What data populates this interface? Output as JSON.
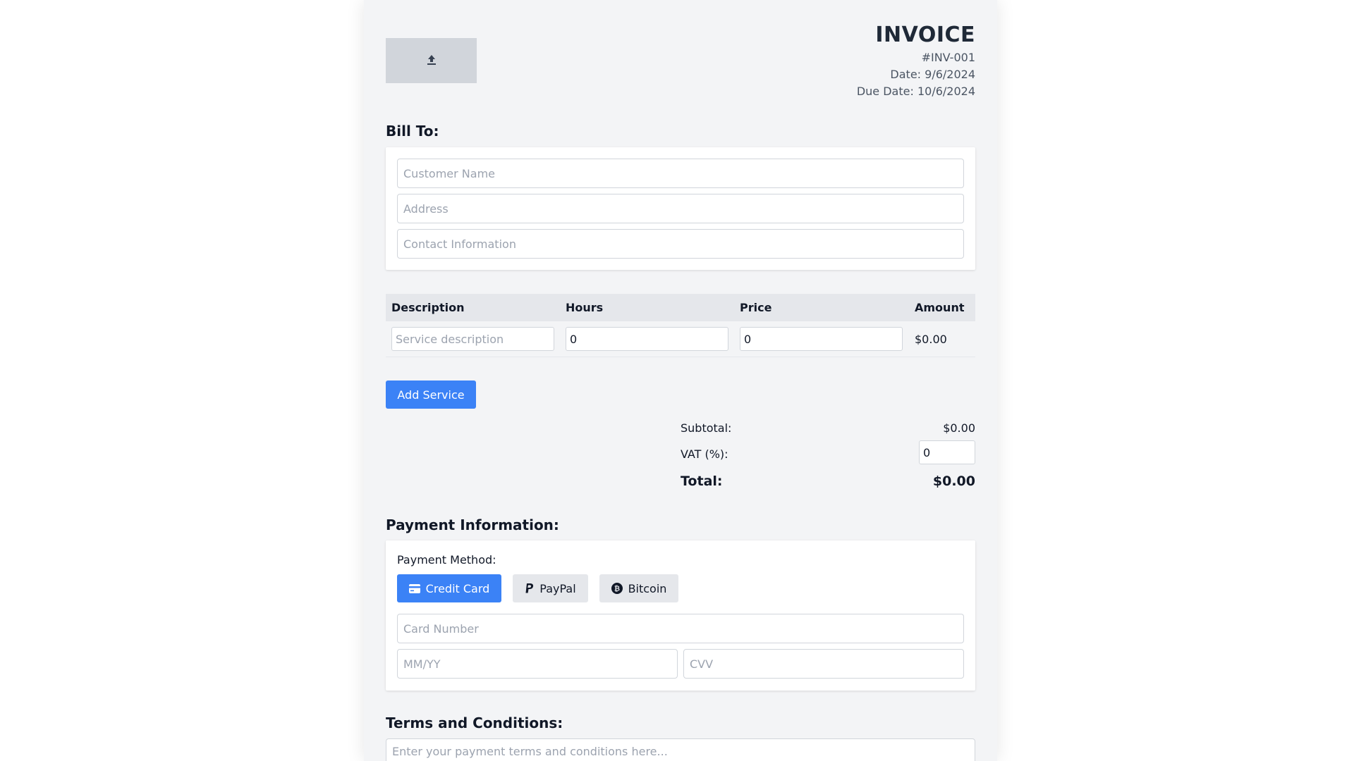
{
  "header": {
    "title": "INVOICE",
    "number": "#INV-001",
    "date": "Date: 9/6/2024",
    "due_date": "Due Date: 10/6/2024",
    "logo_icon": "upload-icon"
  },
  "bill_to": {
    "heading": "Bill To:",
    "customer_placeholder": "Customer Name",
    "address_placeholder": "Address",
    "contact_placeholder": "Contact Information"
  },
  "table": {
    "headers": [
      "Description",
      "Hours",
      "Price",
      "Amount"
    ],
    "rows": [
      {
        "description_placeholder": "Service description",
        "hours": "0",
        "price": "0",
        "amount": "$0.00"
      }
    ]
  },
  "add_service_label": "Add Service",
  "totals": {
    "subtotal_label": "Subtotal:",
    "subtotal_value": "$0.00",
    "vat_label": "VAT (%):",
    "vat_value": "0",
    "total_label": "Total:",
    "total_value": "$0.00"
  },
  "payment": {
    "heading": "Payment Information:",
    "method_label": "Payment Method:",
    "methods": [
      {
        "label": "Credit Card",
        "icon": "credit-card-icon",
        "active": true
      },
      {
        "label": "PayPal",
        "icon": "paypal-icon",
        "active": false
      },
      {
        "label": "Bitcoin",
        "icon": "bitcoin-icon",
        "active": false
      }
    ],
    "card_number_placeholder": "Card Number",
    "expiry_placeholder": "MM/YY",
    "cvv_placeholder": "CVV"
  },
  "terms": {
    "heading": "Terms and Conditions:",
    "placeholder": "Enter your payment terms and conditions here..."
  },
  "colors": {
    "accent": "#3b82f6",
    "page_bg": "#f3f4f6",
    "header_bg": "#e5e7eb",
    "logo_bg": "#d1d5db"
  }
}
